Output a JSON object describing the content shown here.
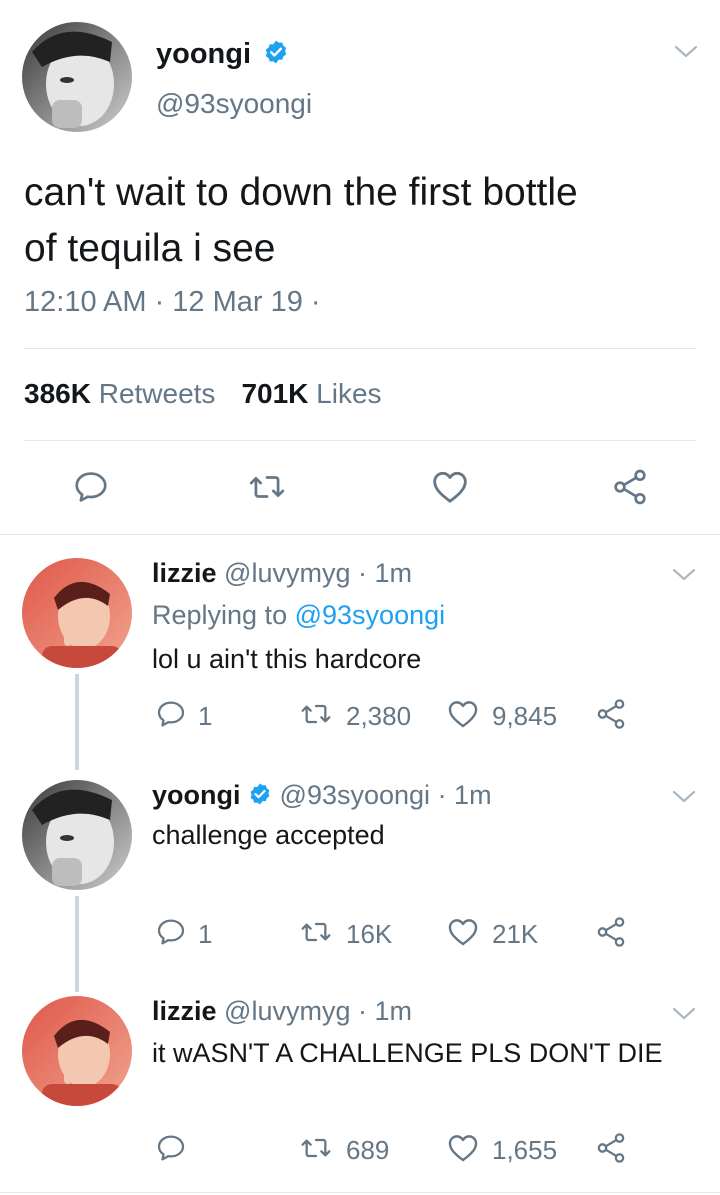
{
  "main_tweet": {
    "name": "yoongi",
    "handle": "@93syoongi",
    "text_line1": "can't wait to down the first bottle",
    "text_line2": "of tequila i see",
    "timestamp": "12:10 AM · 12 Mar 19 ·",
    "retweets_count": "386K",
    "retweets_label": "Retweets",
    "likes_count": "701K",
    "likes_label": "Likes"
  },
  "replies": [
    {
      "name": "lizzie",
      "handle": "@luvymyg",
      "time": "· 1m",
      "replying_prefix": "Replying to",
      "replying_to": "@93syoongi",
      "text": "lol u ain't this hardcore",
      "reply_count": "1",
      "retweet_count": "2,380",
      "like_count": "9,845"
    },
    {
      "name": "yoongi",
      "handle": "@93syoongi",
      "time": "· 1m",
      "text": "challenge accepted",
      "reply_count": "1",
      "retweet_count": "16K",
      "like_count": "21K"
    },
    {
      "name": "lizzie",
      "handle": "@luvymyg",
      "time": "· 1m",
      "text": "it wASN'T A CHALLENGE PLS DON'T DIE",
      "reply_count": "",
      "retweet_count": "689",
      "like_count": "1,655"
    }
  ],
  "colors": {
    "accent": "#1da1f2",
    "text": "#14171a",
    "secondary": "#657786",
    "divider": "#e1e8ed",
    "thread": "#ccd6dd"
  },
  "icons": [
    "chevron-down-icon",
    "verified-icon",
    "reply-icon",
    "retweet-icon",
    "like-icon",
    "share-icon"
  ]
}
